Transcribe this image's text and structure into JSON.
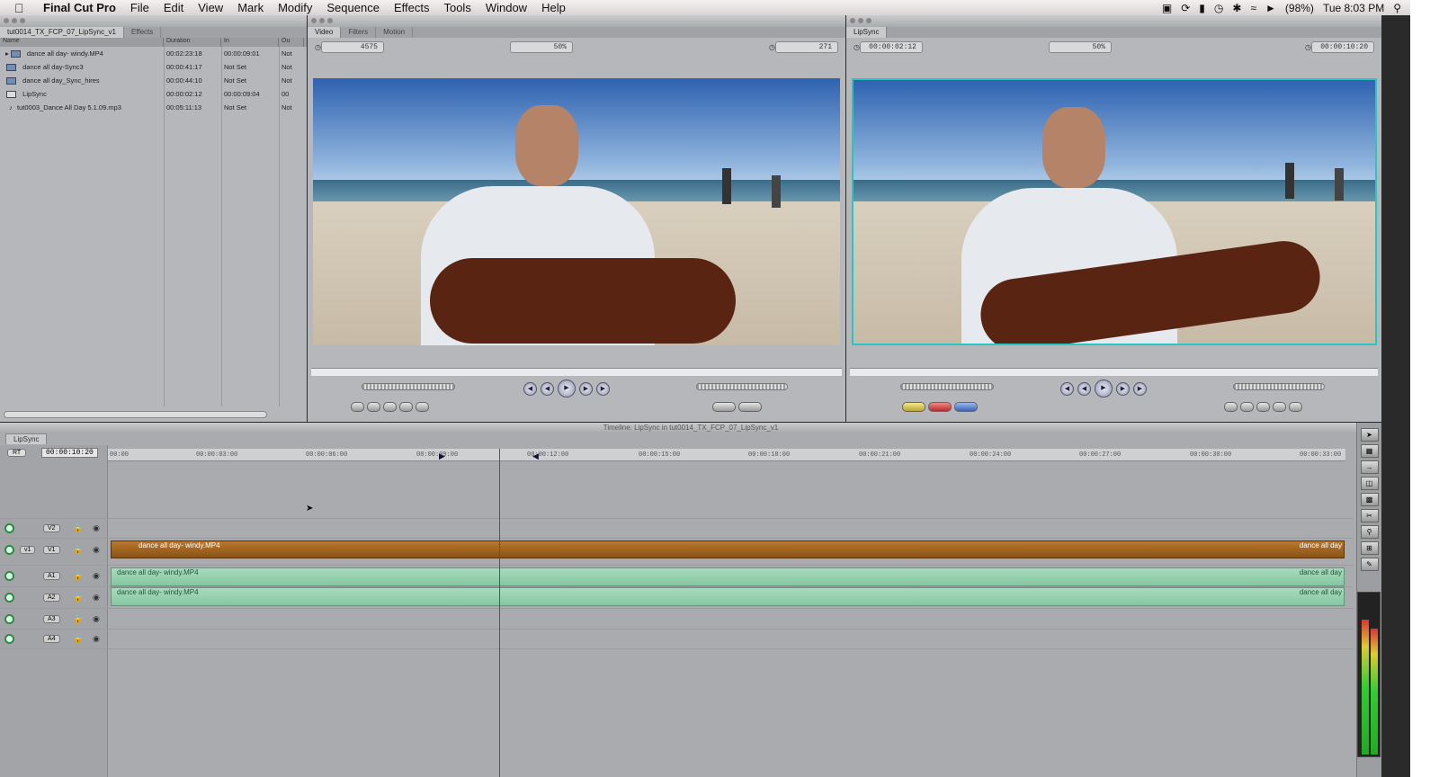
{
  "menubar": {
    "app_name": "Final Cut Pro",
    "items": [
      "File",
      "Edit",
      "View",
      "Mark",
      "Modify",
      "Sequence",
      "Effects",
      "Tools",
      "Window",
      "Help"
    ],
    "battery": "(98%)",
    "clock": "Tue 8:03 PM"
  },
  "browser": {
    "tabs": [
      "tut0014_TX_FCP_07_LipSync_v1",
      "Effects"
    ],
    "columns": [
      "Name",
      "Duration",
      "In",
      "Ou"
    ],
    "rows": [
      {
        "name": "dance all day- windy.MP4",
        "duration": "00:02:23:18",
        "in": "00:00:09:01",
        "out": "Not"
      },
      {
        "name": "dance all day-Sync3",
        "duration": "00:00:41:17",
        "in": "Not Set",
        "out": "Not"
      },
      {
        "name": "dance all day_Sync_hires",
        "duration": "00:00:44:10",
        "in": "Not Set",
        "out": "Not"
      },
      {
        "name": "LipSync",
        "duration": "00:00:02:12",
        "in": "00:00:09:04",
        "out": "00"
      },
      {
        "name": "tut0003_Dance All Day 5.1.09.mp3",
        "duration": "00:05:11:13",
        "in": "Not Set",
        "out": "Not"
      }
    ]
  },
  "viewer": {
    "tabs": [
      "Video",
      "Filters",
      "Motion"
    ],
    "timecode_left": "4575",
    "timecode_right": "271",
    "zoom": "50%"
  },
  "canvas": {
    "tab": "LipSync",
    "timecode_left": "00:00:02:12",
    "timecode_right": "00:00:10:20",
    "zoom": "50%"
  },
  "timeline": {
    "title": "Timeline: LipSync in tut0014_TX_FCP_07_LipSync_v1",
    "tab": "LipSync",
    "rt": "RT",
    "timecode": "00:00:10:20",
    "ruler": [
      "00:00",
      "00:00:03:00",
      "00:00:06:00",
      "00:00:09:00",
      "00:00:12:00",
      "00:00:15:00",
      "00:00:18:00",
      "00:00:21:00",
      "00:00:24:00",
      "00:00:27:00",
      "00:00:30:00",
      "00:00:33:00"
    ],
    "tracks": {
      "v2": "V2",
      "v1": "V1",
      "v1_src": "v1",
      "a1": "A1",
      "a2": "A2",
      "a3": "A3",
      "a4": "A4"
    },
    "clips": {
      "video": "dance all day- windy.MP4",
      "video_end": "dance all day",
      "audio1": "dance all day- windy.MP4",
      "audio2": "dance all day- windy.MP4",
      "audio_end": "dance all day"
    }
  }
}
